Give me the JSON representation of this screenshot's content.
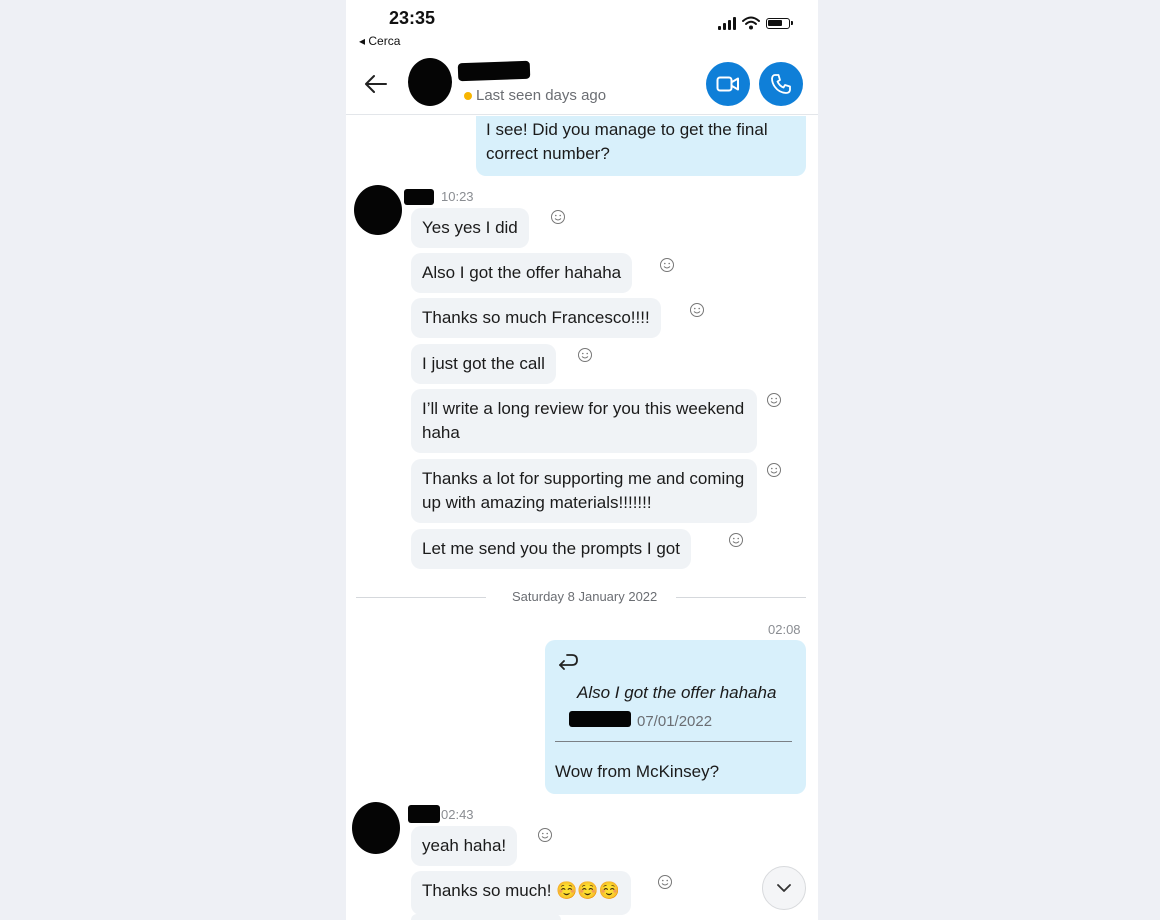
{
  "status_bar": {
    "time": "23:35",
    "back_app": "◂ Cerca"
  },
  "header": {
    "presence": "Last seen days ago"
  },
  "messages": [
    {
      "dir": "out",
      "text": "I see! Did you manage to get the final correct number?"
    },
    {
      "dir": "in",
      "time": "10:23",
      "text": "Yes yes I did"
    },
    {
      "dir": "in",
      "text": "Also I got the offer hahaha"
    },
    {
      "dir": "in",
      "text": "Thanks so much Francesco!!!!"
    },
    {
      "dir": "in",
      "text": "I just got the call"
    },
    {
      "dir": "in",
      "text": "I’ll write a long review for you this weekend haha"
    },
    {
      "dir": "in",
      "text": "Thanks a lot for supporting me and coming up with amazing materials!!!!!!!"
    },
    {
      "dir": "in",
      "text": "Let me send you the prompts I got"
    }
  ],
  "date_divider": "Saturday 8 January 2022",
  "reply_message": {
    "time": "02:08",
    "quoted_text": "Also I got the offer hahaha",
    "quoted_date": "07/01/2022",
    "text": "Wow from McKinsey?"
  },
  "later_messages": [
    {
      "dir": "in",
      "time": "02:43",
      "text": "yeah haha!"
    },
    {
      "dir": "in",
      "text": "Thanks so much! ☺️☺️☺️"
    }
  ],
  "colors": {
    "accent": "#0f7fd8",
    "outgoing_bubble": "#d8f0fb",
    "incoming_bubble": "#f0f3f6",
    "presence_away": "#f7b500"
  },
  "icons": [
    "back-arrow-icon",
    "video-call-icon",
    "phone-call-icon",
    "emoji-react-icon",
    "chevron-down-icon",
    "reply-icon"
  ]
}
